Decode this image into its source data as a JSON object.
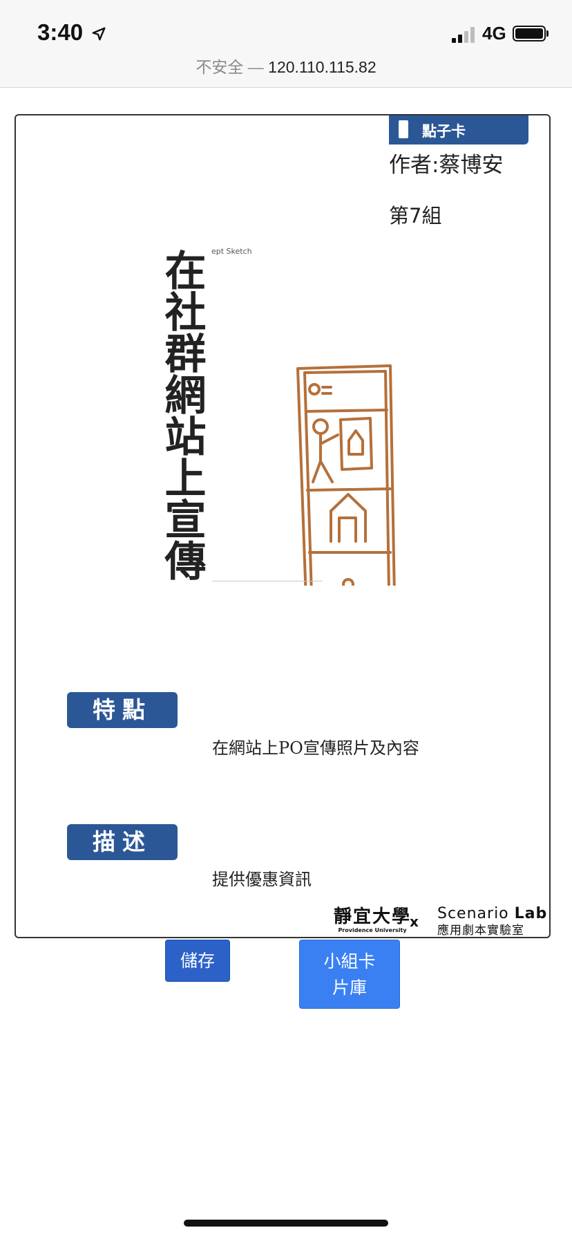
{
  "status_bar": {
    "time": "3:40",
    "network": "4G",
    "location_icon": "location-arrow-icon",
    "signal_icon": "cell-signal-icon",
    "battery_icon": "battery-icon"
  },
  "address_bar": {
    "insecure_label": "不安全 —",
    "host": "120.110.115.82"
  },
  "card": {
    "badge_label": "點子卡",
    "author": "作者:蔡博安",
    "group": "第7組",
    "title": "在社群網站上宣傳",
    "sketch_label": "ept Sketch",
    "sketch_icon": "phone-sketch-icon",
    "feature_tag": "特點",
    "feature_text": "在網站上PO宣傳照片及內容",
    "description_tag": "描述",
    "description_text": "提供優惠資訊",
    "footer": {
      "university_cn": "靜宜大學",
      "university_en": "Providence University",
      "separator": "x",
      "lab_name": "Scenario",
      "lab_name_bold": "Lab",
      "lab_cn": "應用劇本實驗室"
    }
  },
  "buttons": {
    "save": "儲存",
    "library_line1": "小組卡",
    "library_line2": "片庫"
  },
  "colors": {
    "badge_blue": "#2c5796",
    "save_button": "#2c62c8",
    "library_button": "#3a80f3",
    "sketch_ink": "#b5703a"
  }
}
